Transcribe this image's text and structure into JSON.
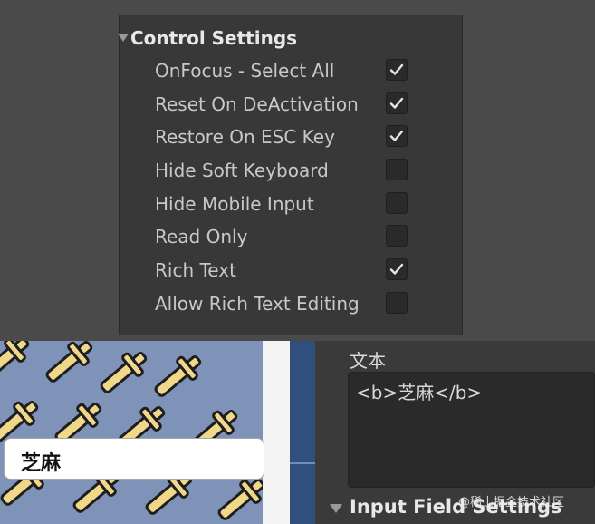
{
  "control_settings": {
    "title": "Control Settings",
    "rows": [
      {
        "label": "OnFocus - Select All",
        "checked": true
      },
      {
        "label": "Reset On DeActivation",
        "checked": true
      },
      {
        "label": "Restore On ESC Key",
        "checked": true
      },
      {
        "label": "Hide Soft Keyboard",
        "checked": false
      },
      {
        "label": "Hide Mobile Input",
        "checked": false
      },
      {
        "label": "Read Only",
        "checked": false
      },
      {
        "label": "Rich Text",
        "checked": true
      },
      {
        "label": "Allow Rich Text Editing",
        "checked": false
      }
    ]
  },
  "game_view": {
    "input_text": "芝麻"
  },
  "inspector": {
    "text_label": "文本",
    "text_value": "<b>芝麻</b>",
    "section_title": "Input Field Settings"
  },
  "watermark": "@稀土掘金技术社区"
}
